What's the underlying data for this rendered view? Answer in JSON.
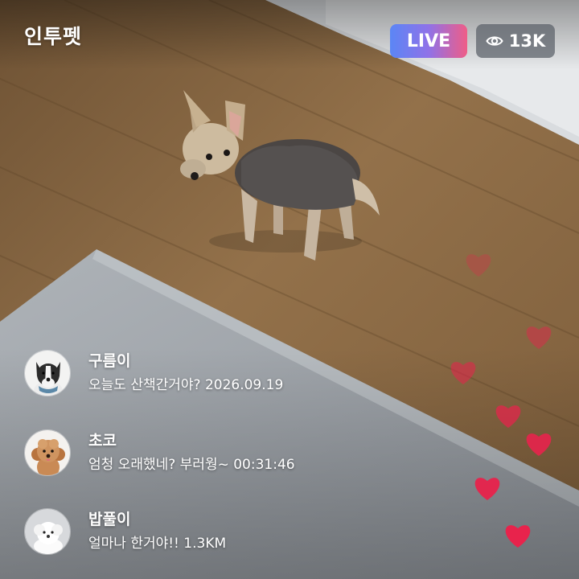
{
  "app": {
    "title": "인투펫"
  },
  "stream": {
    "live_label": "LIVE",
    "viewer_count": "13K"
  },
  "comments": [
    {
      "username": "구름이",
      "message": "오늘도 산책간거야? 2026.09.19"
    },
    {
      "username": "초코",
      "message": "엄청 오래했네? 부러웡~ 00:31:46"
    },
    {
      "username": "밥풀이",
      "message": "얼마나 한거야!! 1.3KM"
    }
  ],
  "icons": {
    "viewers": "eye-icon",
    "reaction": "heart-icon"
  },
  "colors": {
    "live_gradient_start": "#5b86f5",
    "live_gradient_end": "#ef5d87",
    "heart": "#e8234c"
  }
}
